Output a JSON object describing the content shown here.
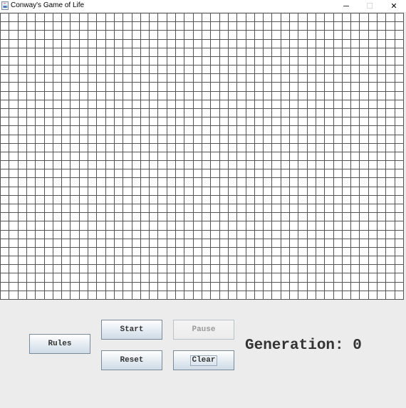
{
  "window": {
    "title": "Conway's Game of Life",
    "minimize_glyph": "─",
    "maximize_glyph": "☐",
    "close_glyph": "✕",
    "app_icon": "java-cup-icon"
  },
  "grid": {
    "columns": 46,
    "rows": 33,
    "line_color": "#555555",
    "background": "#ffffff",
    "live_cells": []
  },
  "controls": {
    "rules_label": "Rules",
    "start_label": "Start",
    "pause_label": "Pause",
    "reset_label": "Reset",
    "clear_label": "Clear",
    "pause_enabled": false
  },
  "status": {
    "generation_label": "Generation:",
    "generation_value": "0",
    "generation_text": "Generation:  0"
  }
}
